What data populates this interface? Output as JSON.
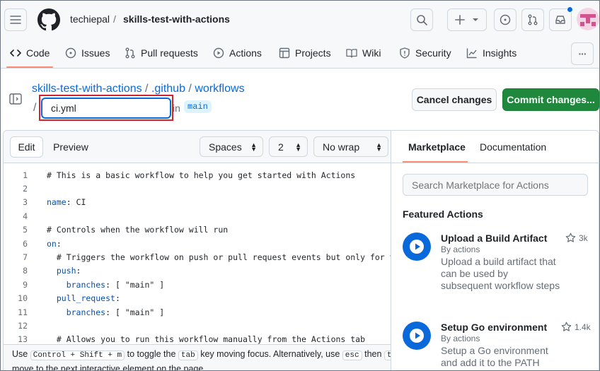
{
  "header": {
    "owner": "techiepal",
    "separator": "/",
    "repo": "skills-test-with-actions"
  },
  "repo_nav": {
    "tabs": [
      {
        "label": "Code",
        "icon": "code-icon",
        "active": true
      },
      {
        "label": "Issues",
        "icon": "issue-opened-icon"
      },
      {
        "label": "Pull requests",
        "icon": "git-pull-request-icon"
      },
      {
        "label": "Actions",
        "icon": "play-icon"
      },
      {
        "label": "Projects",
        "icon": "table-icon"
      },
      {
        "label": "Wiki",
        "icon": "book-icon"
      },
      {
        "label": "Security",
        "icon": "shield-icon"
      },
      {
        "label": "Insights",
        "icon": "graph-icon"
      }
    ],
    "more": "···"
  },
  "editor_header": {
    "repo_link": "skills-test-with-actions",
    "sep1": " / ",
    "dir1": ".github",
    "sep2": " / ",
    "dir2": "workflows",
    "slash": "/",
    "filename": "ci.yml",
    "in_label": "in",
    "branch": "main",
    "cancel_label": "Cancel changes",
    "commit_label": "Commit changes..."
  },
  "editor": {
    "edit_tab": "Edit",
    "preview_tab": "Preview",
    "indent_mode": "Spaces",
    "indent_size": "2",
    "wrap_mode": "No wrap",
    "lines": [
      {
        "n": "1",
        "text": "# This is a basic workflow to help you get started with Actions"
      },
      {
        "n": "2",
        "text": ""
      },
      {
        "n": "3",
        "key": "name",
        "text": ": CI"
      },
      {
        "n": "4",
        "text": ""
      },
      {
        "n": "5",
        "text": "# Controls when the workflow will run"
      },
      {
        "n": "6",
        "key": "on",
        "text": ":"
      },
      {
        "n": "7",
        "text": "  # Triggers the workflow on push or pull request events but only for the \"m"
      },
      {
        "n": "8",
        "key": "  push",
        "text": ":"
      },
      {
        "n": "9",
        "key": "    branches",
        "text": ": [ \"main\" ]"
      },
      {
        "n": "10",
        "key": "  pull_request",
        "text": ":"
      },
      {
        "n": "11",
        "key": "    branches",
        "text": ": [ \"main\" ]"
      },
      {
        "n": "12",
        "text": ""
      },
      {
        "n": "13",
        "text": "  # Allows you to run this workflow manually from the Actions tab"
      }
    ],
    "hint": {
      "use1": "Use",
      "keys1": "Control + Shift + m",
      "mid1": "to toggle the",
      "tab_key": "tab",
      "mid2": "key moving focus. Alternatively, use",
      "esc_key": "esc",
      "then": "then",
      "tab_key2": "tab",
      "line2": "move to the next interactive element on the page."
    }
  },
  "marketplace": {
    "tab_marketplace": "Marketplace",
    "tab_documentation": "Documentation",
    "search_placeholder": "Search Marketplace for Actions",
    "featured_title": "Featured Actions",
    "actions": [
      {
        "title": "Upload a Build Artifact",
        "by": "By actions",
        "desc": "Upload a build artifact that can be used by subsequent workflow steps",
        "stars": "3k"
      },
      {
        "title": "Setup Go environment",
        "by": "By actions",
        "desc": "Setup a Go environment and add it to the PATH",
        "stars": "1.4k"
      }
    ]
  },
  "colors": {
    "accent": "#0969da",
    "primary_button": "#1f883d",
    "highlight_box": "#d1242f",
    "active_tab_underline": "#fd8c73"
  }
}
